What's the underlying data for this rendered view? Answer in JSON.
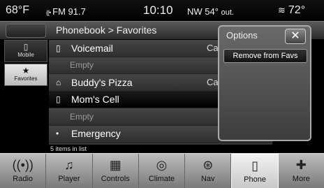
{
  "status": {
    "outside_temp_left": "68°",
    "temp_unit_left": "F",
    "radio": "FM 91.7",
    "clock": "10:10",
    "compass": "NW",
    "outside_temp": "54°",
    "outside_label": "out.",
    "interior_temp": "72°"
  },
  "header": {
    "title": "Phonebook > Favorites"
  },
  "tabs": [
    {
      "label": "Mobile",
      "icon": "phone-icon"
    },
    {
      "label": "Favorites",
      "icon": "star-icon"
    }
  ],
  "list": [
    {
      "label": "Voicemail",
      "icon": "phone-icon",
      "trail": "Ca"
    },
    {
      "label": "Empty"
    },
    {
      "label": "Buddy's Pizza",
      "icon": "home-icon",
      "trail": "Ca"
    },
    {
      "label": "Mom's Cell",
      "icon": "phone-icon",
      "selected": true
    },
    {
      "label": "Empty"
    },
    {
      "label": "Emergency",
      "icon": "dot-icon"
    }
  ],
  "count_text": "5 items in list",
  "popup": {
    "title": "Options",
    "option": "Remove from Favs"
  },
  "bottom": [
    {
      "label": "Radio",
      "icon": "radio-icon"
    },
    {
      "label": "Player",
      "icon": "player-icon"
    },
    {
      "label": "Controls",
      "icon": "controls-icon"
    },
    {
      "label": "Climate",
      "icon": "climate-icon"
    },
    {
      "label": "Nav",
      "icon": "compass-icon"
    },
    {
      "label": "Phone",
      "icon": "phone-icon",
      "selected": true
    },
    {
      "label": "More",
      "icon": "plus-icon"
    }
  ]
}
